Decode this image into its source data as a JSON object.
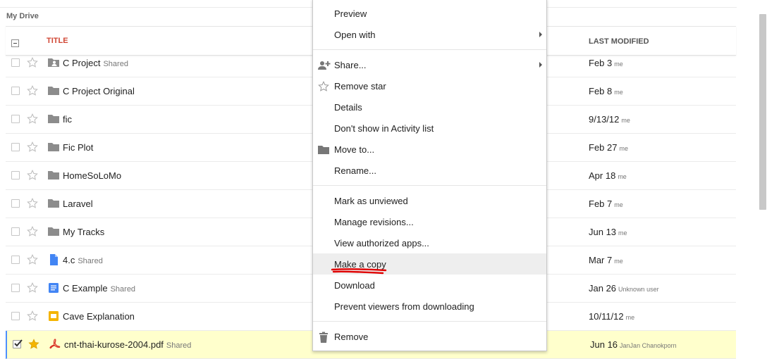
{
  "breadcrumb": "My Drive",
  "header": {
    "title": "TITLE",
    "last_modified": "LAST MODIFIED"
  },
  "files": [
    {
      "name": "C Project",
      "shared": "Shared",
      "type": "shared-folder",
      "date": "Feb 3",
      "owner": "me",
      "starred": false,
      "checked": false
    },
    {
      "name": "C Project Original",
      "shared": "",
      "type": "folder",
      "date": "Feb 8",
      "owner": "me",
      "starred": false,
      "checked": false
    },
    {
      "name": "fic",
      "shared": "",
      "type": "folder",
      "date": "9/13/12",
      "owner": "me",
      "starred": false,
      "checked": false
    },
    {
      "name": "Fic Plot",
      "shared": "",
      "type": "folder",
      "date": "Feb 27",
      "owner": "me",
      "starred": false,
      "checked": false
    },
    {
      "name": "HomeSoLoMo",
      "shared": "",
      "type": "folder",
      "date": "Apr 18",
      "owner": "me",
      "starred": false,
      "checked": false
    },
    {
      "name": "Laravel",
      "shared": "",
      "type": "folder",
      "date": "Feb 7",
      "owner": "me",
      "starred": false,
      "checked": false
    },
    {
      "name": "My Tracks",
      "shared": "",
      "type": "folder",
      "date": "Jun 13",
      "owner": "me",
      "starred": false,
      "checked": false
    },
    {
      "name": "4.c",
      "shared": "Shared",
      "type": "file",
      "date": "Mar 7",
      "owner": "me",
      "starred": false,
      "checked": false
    },
    {
      "name": "C Example",
      "shared": "Shared",
      "type": "document",
      "date": "Jan 26",
      "owner": "Unknown user",
      "starred": false,
      "checked": false
    },
    {
      "name": "Cave Explanation",
      "shared": "",
      "type": "presentation",
      "date": "10/11/12",
      "owner": "me",
      "starred": false,
      "checked": false
    },
    {
      "name": "cnt-thai-kurose-2004.pdf",
      "shared": "Shared",
      "type": "pdf",
      "date": "Jun 16",
      "owner": "JanJan Chanokporn",
      "starred": true,
      "checked": true
    }
  ],
  "menu": {
    "preview": "Preview",
    "open_with": "Open with",
    "share": "Share...",
    "remove_star": "Remove star",
    "details": "Details",
    "dont_show": "Don't show in Activity list",
    "move_to": "Move to...",
    "rename": "Rename...",
    "mark_unviewed": "Mark as unviewed",
    "manage_revisions": "Manage revisions...",
    "view_apps": "View authorized apps...",
    "make_copy": "Make a copy",
    "download": "Download",
    "prevent_download": "Prevent viewers from downloading",
    "remove": "Remove",
    "highlighted": "make_copy"
  },
  "colors": {
    "title_accent": "#d14836",
    "folder": "#8c8c8c",
    "doc": "#4285f4",
    "slides": "#f4b400",
    "pdf": "#d93025",
    "star_on": "#f4b400",
    "selected_row": "#ffffcc",
    "annotation": "#e00000"
  },
  "icons": {
    "share": "person-add-icon",
    "remove_star": "star-outline-icon",
    "move_to": "folder-icon",
    "remove": "trash-icon"
  }
}
